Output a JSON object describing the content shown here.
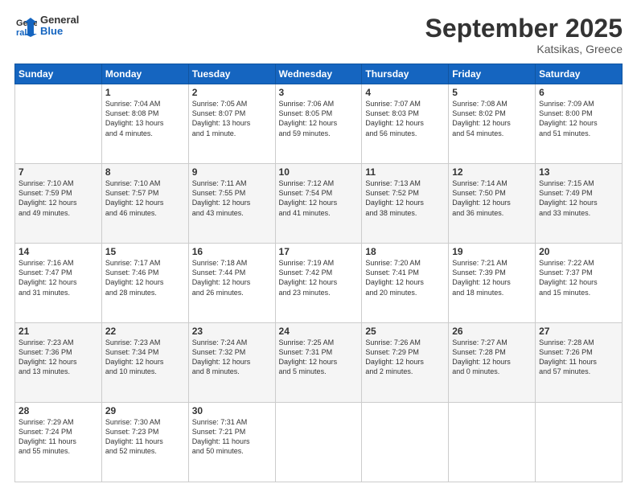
{
  "header": {
    "logo_general": "General",
    "logo_blue": "Blue",
    "month_title": "September 2025",
    "location": "Katsikas, Greece"
  },
  "days_of_week": [
    "Sunday",
    "Monday",
    "Tuesday",
    "Wednesday",
    "Thursday",
    "Friday",
    "Saturday"
  ],
  "weeks": [
    [
      {
        "day": "",
        "info": ""
      },
      {
        "day": "1",
        "info": "Sunrise: 7:04 AM\nSunset: 8:08 PM\nDaylight: 13 hours\nand 4 minutes."
      },
      {
        "day": "2",
        "info": "Sunrise: 7:05 AM\nSunset: 8:07 PM\nDaylight: 13 hours\nand 1 minute."
      },
      {
        "day": "3",
        "info": "Sunrise: 7:06 AM\nSunset: 8:05 PM\nDaylight: 12 hours\nand 59 minutes."
      },
      {
        "day": "4",
        "info": "Sunrise: 7:07 AM\nSunset: 8:03 PM\nDaylight: 12 hours\nand 56 minutes."
      },
      {
        "day": "5",
        "info": "Sunrise: 7:08 AM\nSunset: 8:02 PM\nDaylight: 12 hours\nand 54 minutes."
      },
      {
        "day": "6",
        "info": "Sunrise: 7:09 AM\nSunset: 8:00 PM\nDaylight: 12 hours\nand 51 minutes."
      }
    ],
    [
      {
        "day": "7",
        "info": "Sunrise: 7:10 AM\nSunset: 7:59 PM\nDaylight: 12 hours\nand 49 minutes."
      },
      {
        "day": "8",
        "info": "Sunrise: 7:10 AM\nSunset: 7:57 PM\nDaylight: 12 hours\nand 46 minutes."
      },
      {
        "day": "9",
        "info": "Sunrise: 7:11 AM\nSunset: 7:55 PM\nDaylight: 12 hours\nand 43 minutes."
      },
      {
        "day": "10",
        "info": "Sunrise: 7:12 AM\nSunset: 7:54 PM\nDaylight: 12 hours\nand 41 minutes."
      },
      {
        "day": "11",
        "info": "Sunrise: 7:13 AM\nSunset: 7:52 PM\nDaylight: 12 hours\nand 38 minutes."
      },
      {
        "day": "12",
        "info": "Sunrise: 7:14 AM\nSunset: 7:50 PM\nDaylight: 12 hours\nand 36 minutes."
      },
      {
        "day": "13",
        "info": "Sunrise: 7:15 AM\nSunset: 7:49 PM\nDaylight: 12 hours\nand 33 minutes."
      }
    ],
    [
      {
        "day": "14",
        "info": "Sunrise: 7:16 AM\nSunset: 7:47 PM\nDaylight: 12 hours\nand 31 minutes."
      },
      {
        "day": "15",
        "info": "Sunrise: 7:17 AM\nSunset: 7:46 PM\nDaylight: 12 hours\nand 28 minutes."
      },
      {
        "day": "16",
        "info": "Sunrise: 7:18 AM\nSunset: 7:44 PM\nDaylight: 12 hours\nand 26 minutes."
      },
      {
        "day": "17",
        "info": "Sunrise: 7:19 AM\nSunset: 7:42 PM\nDaylight: 12 hours\nand 23 minutes."
      },
      {
        "day": "18",
        "info": "Sunrise: 7:20 AM\nSunset: 7:41 PM\nDaylight: 12 hours\nand 20 minutes."
      },
      {
        "day": "19",
        "info": "Sunrise: 7:21 AM\nSunset: 7:39 PM\nDaylight: 12 hours\nand 18 minutes."
      },
      {
        "day": "20",
        "info": "Sunrise: 7:22 AM\nSunset: 7:37 PM\nDaylight: 12 hours\nand 15 minutes."
      }
    ],
    [
      {
        "day": "21",
        "info": "Sunrise: 7:23 AM\nSunset: 7:36 PM\nDaylight: 12 hours\nand 13 minutes."
      },
      {
        "day": "22",
        "info": "Sunrise: 7:23 AM\nSunset: 7:34 PM\nDaylight: 12 hours\nand 10 minutes."
      },
      {
        "day": "23",
        "info": "Sunrise: 7:24 AM\nSunset: 7:32 PM\nDaylight: 12 hours\nand 8 minutes."
      },
      {
        "day": "24",
        "info": "Sunrise: 7:25 AM\nSunset: 7:31 PM\nDaylight: 12 hours\nand 5 minutes."
      },
      {
        "day": "25",
        "info": "Sunrise: 7:26 AM\nSunset: 7:29 PM\nDaylight: 12 hours\nand 2 minutes."
      },
      {
        "day": "26",
        "info": "Sunrise: 7:27 AM\nSunset: 7:28 PM\nDaylight: 12 hours\nand 0 minutes."
      },
      {
        "day": "27",
        "info": "Sunrise: 7:28 AM\nSunset: 7:26 PM\nDaylight: 11 hours\nand 57 minutes."
      }
    ],
    [
      {
        "day": "28",
        "info": "Sunrise: 7:29 AM\nSunset: 7:24 PM\nDaylight: 11 hours\nand 55 minutes."
      },
      {
        "day": "29",
        "info": "Sunrise: 7:30 AM\nSunset: 7:23 PM\nDaylight: 11 hours\nand 52 minutes."
      },
      {
        "day": "30",
        "info": "Sunrise: 7:31 AM\nSunset: 7:21 PM\nDaylight: 11 hours\nand 50 minutes."
      },
      {
        "day": "",
        "info": ""
      },
      {
        "day": "",
        "info": ""
      },
      {
        "day": "",
        "info": ""
      },
      {
        "day": "",
        "info": ""
      }
    ]
  ]
}
